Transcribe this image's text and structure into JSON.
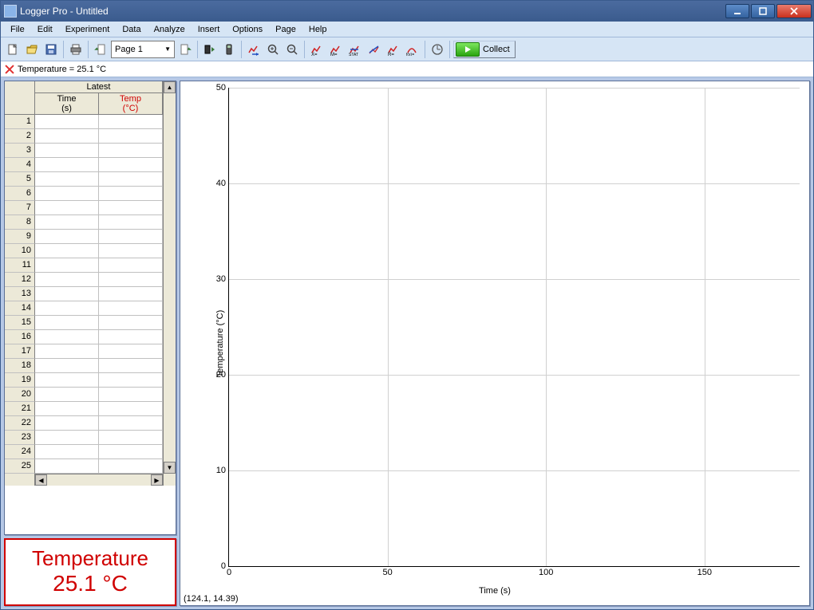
{
  "titlebar": {
    "title": "Logger Pro - Untitled"
  },
  "menu": [
    "File",
    "Edit",
    "Experiment",
    "Data",
    "Analyze",
    "Insert",
    "Options",
    "Page",
    "Help"
  ],
  "toolbar": {
    "page_selected": "Page 1",
    "collect_label": "Collect"
  },
  "sensorbar": {
    "reading": "Temperature =  25.1 °C"
  },
  "table": {
    "latest_label": "Latest",
    "col1_name": "Time",
    "col1_unit": "(s)",
    "col2_name": "Temp",
    "col2_unit": "(°C)",
    "visible_rows": 25
  },
  "meter": {
    "label": "Temperature",
    "value": "25.1 °C"
  },
  "chart_data": {
    "type": "line",
    "series": [
      {
        "name": "Temperature",
        "values": []
      }
    ],
    "x": [],
    "xlabel": "Time (s)",
    "ylabel": "Temperature (°C)",
    "xlim": [
      0,
      180
    ],
    "ylim": [
      0,
      50
    ],
    "xticks": [
      0,
      50,
      100,
      150
    ],
    "yticks": [
      0,
      10,
      20,
      30,
      40,
      50
    ],
    "cursor_readout": "(124.1, 14.39)"
  }
}
